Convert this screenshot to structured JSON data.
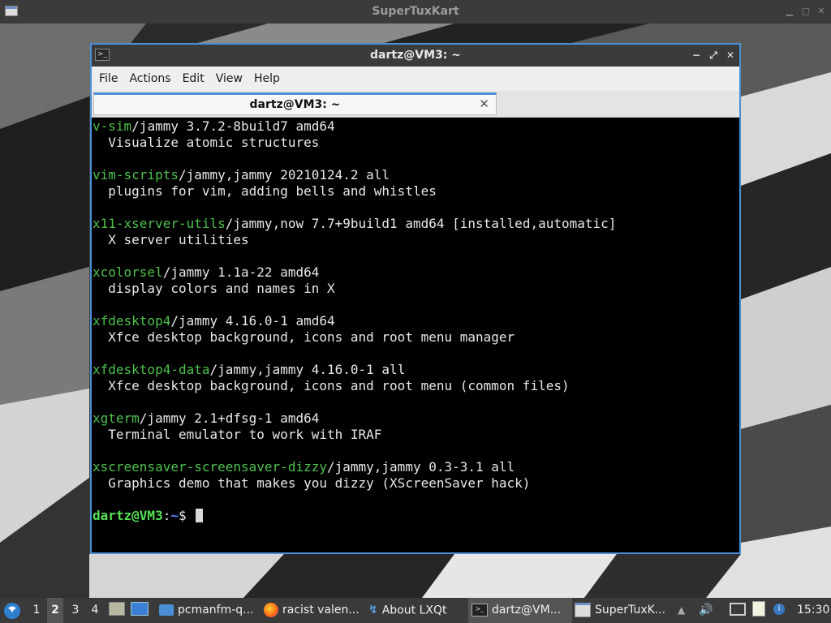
{
  "outer_window": {
    "title": "SuperTuxKart"
  },
  "terminal_window": {
    "title": "dartz@VM3: ~",
    "menu": [
      "File",
      "Actions",
      "Edit",
      "View",
      "Help"
    ],
    "tab_label": "dartz@VM3: ~"
  },
  "terminal": {
    "lines": [
      {
        "pkg": "v-sim",
        "rest": "/jammy 3.7.2-8build7 amd64"
      },
      {
        "text": "  Visualize atomic structures"
      },
      {
        "text": ""
      },
      {
        "pkg": "vim-scripts",
        "rest": "/jammy,jammy 20210124.2 all"
      },
      {
        "text": "  plugins for vim, adding bells and whistles"
      },
      {
        "text": ""
      },
      {
        "pkg": "x11-xserver-utils",
        "rest": "/jammy,now 7.7+9build1 amd64 [installed,automatic]"
      },
      {
        "text": "  X server utilities"
      },
      {
        "text": ""
      },
      {
        "pkg": "xcolorsel",
        "rest": "/jammy 1.1a-22 amd64"
      },
      {
        "text": "  display colors and names in X"
      },
      {
        "text": ""
      },
      {
        "pkg": "xfdesktop4",
        "rest": "/jammy 4.16.0-1 amd64"
      },
      {
        "text": "  Xfce desktop background, icons and root menu manager"
      },
      {
        "text": ""
      },
      {
        "pkg": "xfdesktop4-data",
        "rest": "/jammy,jammy 4.16.0-1 all"
      },
      {
        "text": "  Xfce desktop background, icons and root menu (common files)"
      },
      {
        "text": ""
      },
      {
        "pkg": "xgterm",
        "rest": "/jammy 2.1+dfsg-1 amd64"
      },
      {
        "text": "  Terminal emulator to work with IRAF"
      },
      {
        "text": ""
      },
      {
        "pkg": "xscreensaver-screensaver-dizzy",
        "rest": "/jammy,jammy 0.3-3.1 all"
      },
      {
        "text": "  Graphics demo that makes you dizzy (XScreenSaver hack)"
      },
      {
        "text": ""
      }
    ],
    "prompt_user": "dartz@VM3",
    "prompt_sep": ":",
    "prompt_path": "~",
    "prompt_symbol": "$"
  },
  "taskbar": {
    "workspaces": [
      "1",
      "2",
      "3",
      "4"
    ],
    "active_workspace": "2",
    "tasks": [
      {
        "label": "pcmanfm-q...",
        "icon": "folder-icon"
      },
      {
        "label": "racist valen...",
        "icon": "firefox-icon"
      },
      {
        "label": "About LXQt",
        "icon": "lxqt-icon"
      },
      {
        "label": "dartz@VM...",
        "icon": "terminal-icon"
      },
      {
        "label": "SuperTuxK...",
        "icon": "window-icon"
      }
    ],
    "clock": "15:30"
  },
  "colors": {
    "accent": "#4a90d9",
    "package_name": "#4ec14e",
    "prompt_user": "#55e055",
    "prompt_path": "#5c86ff"
  }
}
